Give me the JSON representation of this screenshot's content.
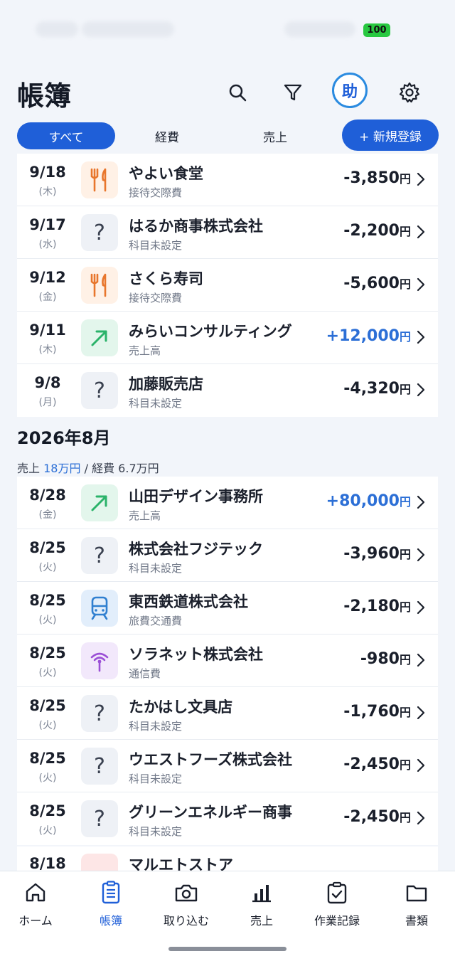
{
  "status": {
    "battery": "100"
  },
  "header": {
    "title": "帳簿",
    "assistant_label": "助"
  },
  "tabs": [
    {
      "label": "すべて"
    },
    {
      "label": "経費"
    },
    {
      "label": "売上"
    }
  ],
  "new_button_label": "+ 新規登録",
  "september_entries": [
    {
      "date": "9/18",
      "weekday": "(木)",
      "name": "やよい食堂",
      "category": "接待交際費",
      "amount": "-3,850",
      "unit": "円",
      "icon": "food-icon"
    },
    {
      "date": "9/17",
      "weekday": "(水)",
      "name": "はるか商事株式会社",
      "category": "科目未設定",
      "amount": "-2,200",
      "unit": "円",
      "icon": "unknown-icon"
    },
    {
      "date": "9/12",
      "weekday": "(金)",
      "name": "さくら寿司",
      "category": "接待交際費",
      "amount": "-5,600",
      "unit": "円",
      "icon": "food-icon"
    },
    {
      "date": "9/11",
      "weekday": "(木)",
      "name": "みらいコンサルティング",
      "category": "売上高",
      "amount": "+12,000",
      "unit": "円",
      "icon": "sales-arrow-icon"
    },
    {
      "date": "9/8",
      "weekday": "(月)",
      "name": "加藤販売店",
      "category": "科目未設定",
      "amount": "-4,320",
      "unit": "円",
      "icon": "unknown-icon"
    }
  ],
  "august": {
    "title": "2026年8月",
    "summary_sales_label": "売上",
    "summary_sales_value": "18万円",
    "summary_sep": "/",
    "summary_expense_label": "経費",
    "summary_expense_value": "6.7万円"
  },
  "august_entries": [
    {
      "date": "8/28",
      "weekday": "(金)",
      "name": "山田デザイン事務所",
      "category": "売上高",
      "amount": "+80,000",
      "unit": "円",
      "icon": "sales-arrow-icon"
    },
    {
      "date": "8/25",
      "weekday": "(火)",
      "name": "株式会社フジテック",
      "category": "科目未設定",
      "amount": "-3,960",
      "unit": "円",
      "icon": "unknown-icon"
    },
    {
      "date": "8/25",
      "weekday": "(火)",
      "name": "東西鉄道株式会社",
      "category": "旅費交通費",
      "amount": "-2,180",
      "unit": "円",
      "icon": "train-icon"
    },
    {
      "date": "8/25",
      "weekday": "(火)",
      "name": "ソラネット株式会社",
      "category": "通信費",
      "amount": "-980",
      "unit": "円",
      "icon": "antenna-icon"
    },
    {
      "date": "8/25",
      "weekday": "(火)",
      "name": "たかはし文具店",
      "category": "科目未設定",
      "amount": "-1,760",
      "unit": "円",
      "icon": "unknown-icon"
    },
    {
      "date": "8/25",
      "weekday": "(火)",
      "name": "ウエストフーズ株式会社",
      "category": "科目未設定",
      "amount": "-2,450",
      "unit": "円",
      "icon": "unknown-icon"
    },
    {
      "date": "8/25",
      "weekday": "(火)",
      "name": "グリーンエネルギー商事",
      "category": "科目未設定",
      "amount": "-2,450",
      "unit": "円",
      "icon": "unknown-icon"
    }
  ],
  "partial_entry": {
    "date": "8/18",
    "name": "マルエトストア"
  },
  "bottom_nav": [
    {
      "label": "ホーム",
      "icon": "home-icon"
    },
    {
      "label": "帳簿",
      "icon": "ledger-icon"
    },
    {
      "label": "取り込む",
      "icon": "camera-icon"
    },
    {
      "label": "売上",
      "icon": "bar-chart-icon"
    },
    {
      "label": "作業記録",
      "icon": "clipboard-check-icon"
    },
    {
      "label": "書類",
      "icon": "folder-icon"
    }
  ],
  "colors": {
    "accent": "#1f5fd8",
    "positive": "#2c6fd6",
    "food": "#e8762c",
    "sales": "#2bb36a",
    "train": "#2f7fd0",
    "telecom": "#9b4fd6"
  }
}
